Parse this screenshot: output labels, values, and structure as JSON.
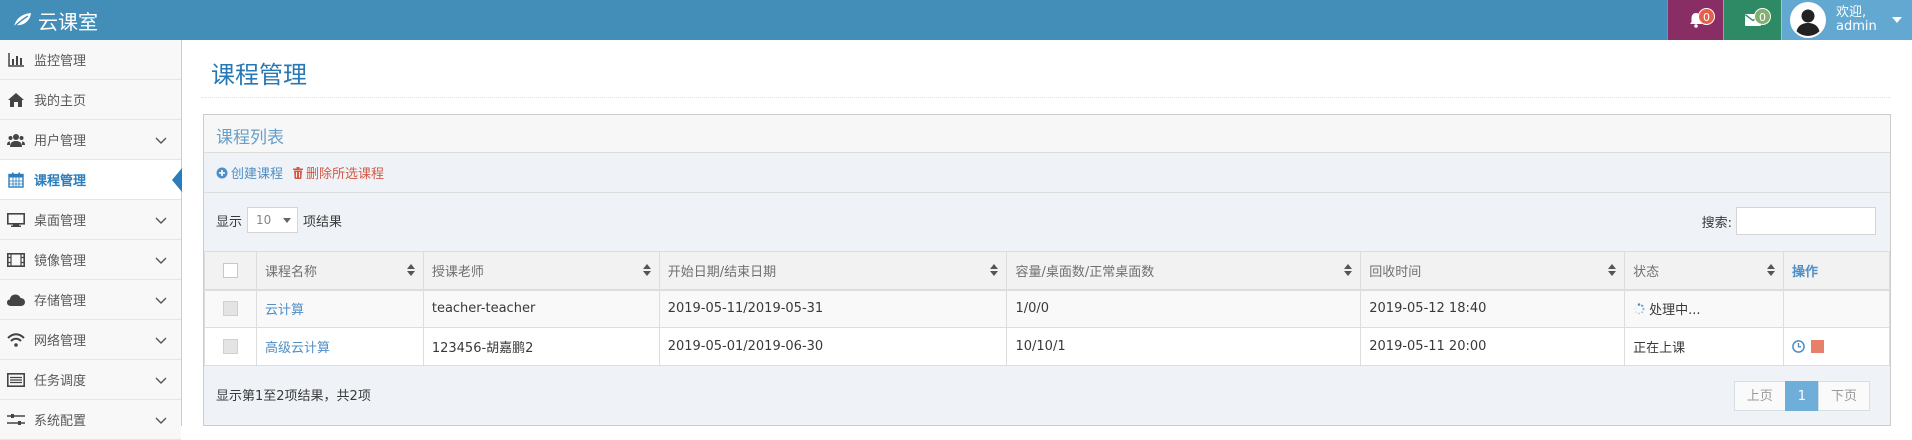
{
  "navbar": {
    "brand": "云课室",
    "notifications_count": "0",
    "messages_count": "0",
    "greeting": "欢迎,",
    "username": "admin"
  },
  "sidebar": {
    "items": [
      {
        "label": "监控管理",
        "icon": "bar-chart-icon",
        "has_arrow": false
      },
      {
        "label": "我的主页",
        "icon": "home-icon",
        "has_arrow": false
      },
      {
        "label": "用户管理",
        "icon": "users-icon",
        "has_arrow": true
      },
      {
        "label": "课程管理",
        "icon": "calendar-icon",
        "has_arrow": false,
        "active": true
      },
      {
        "label": "桌面管理",
        "icon": "desktop-icon",
        "has_arrow": true
      },
      {
        "label": "镜像管理",
        "icon": "film-icon",
        "has_arrow": true
      },
      {
        "label": "存储管理",
        "icon": "cloud-icon",
        "has_arrow": true
      },
      {
        "label": "网络管理",
        "icon": "wifi-icon",
        "has_arrow": true
      },
      {
        "label": "任务调度",
        "icon": "list-icon",
        "has_arrow": true
      },
      {
        "label": "系统配置",
        "icon": "sliders-icon",
        "has_arrow": true
      }
    ]
  },
  "page": {
    "title": "课程管理"
  },
  "widget": {
    "title": "课程列表",
    "create_label": "创建课程",
    "delete_label": "删除所选课程"
  },
  "controls": {
    "show_prefix": "显示",
    "page_length": "10",
    "show_suffix": "项结果",
    "search_label": "搜索:"
  },
  "table": {
    "headers": [
      "课程名称",
      "授课老师",
      "开始日期/结束日期",
      "容量/桌面数/正常桌面数",
      "回收时间",
      "状态",
      "操作"
    ],
    "rows": [
      {
        "name": "云计算",
        "teacher": "teacher-teacher",
        "dates": "2019-05-11/2019-05-31",
        "capacity": "1/0/0",
        "recycle": "2019-05-12 18:40",
        "status": "处理中..."
      },
      {
        "name": "高级云计算",
        "teacher": "123456-胡嘉鹏2",
        "dates": "2019-05-01/2019-06-30",
        "capacity": "10/10/1",
        "recycle": "2019-05-11 20:00",
        "status": "正在上课"
      }
    ]
  },
  "footer": {
    "info": "显示第1至2项结果，共2项",
    "prev": "上页",
    "current_page": "1",
    "next": "下页"
  },
  "colors": {
    "navbar": "#438eb9",
    "accent": "#2b7dbc",
    "bell_box": "#892e65",
    "mail_box": "#2e8965",
    "danger": "#d15b47"
  }
}
